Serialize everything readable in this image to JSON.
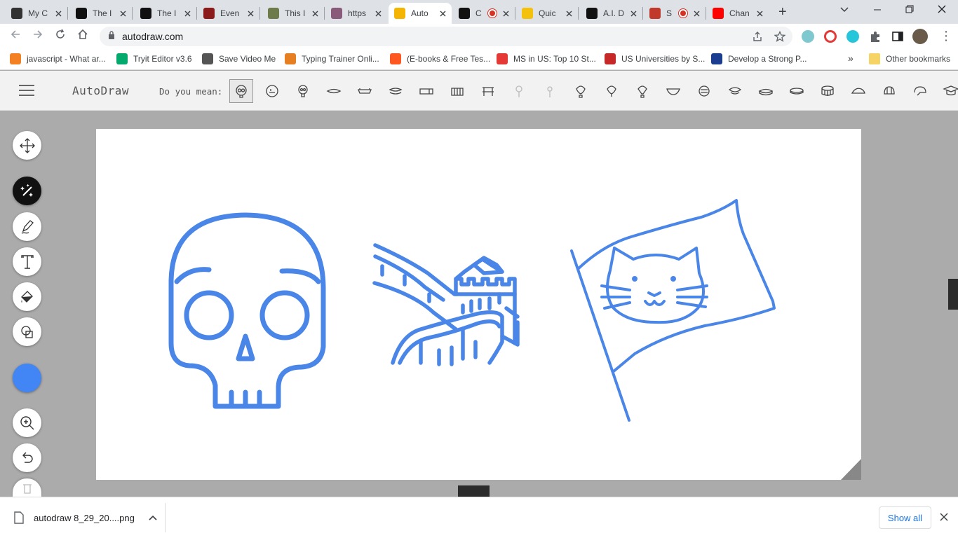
{
  "tabs": [
    {
      "title": "My C",
      "icon": "sparkle-icon",
      "color": "#333333"
    },
    {
      "title": "The I",
      "icon": "e-logo-icon",
      "color": "#111111"
    },
    {
      "title": "The I",
      "icon": "openai-icon",
      "color": "#111111"
    },
    {
      "title": "Even",
      "icon": "hat-icon",
      "color": "#8b1a1a"
    },
    {
      "title": "This I",
      "icon": "photo-icon",
      "color": "#6d7a4a"
    },
    {
      "title": "https",
      "icon": "portrait-icon",
      "color": "#8a5a7a"
    },
    {
      "title": "Auto",
      "icon": "autodraw-icon",
      "color": "#f4b400",
      "active": true
    },
    {
      "title": "C",
      "icon": "mask-icon",
      "color": "#111111",
      "recording": true
    },
    {
      "title": "Quic",
      "icon": "pencil-icon",
      "color": "#f4c20d"
    },
    {
      "title": "A.I. D",
      "icon": "piano-icon",
      "color": "#111111"
    },
    {
      "title": "S",
      "icon": "game-icon",
      "color": "#c0392b",
      "recording": true
    },
    {
      "title": "Chan",
      "icon": "youtube-icon",
      "color": "#ff0000"
    }
  ],
  "address": {
    "url": "autodraw.com"
  },
  "bookmarks": [
    {
      "label": "javascript - What ar...",
      "color": "#f48024"
    },
    {
      "label": "Tryit Editor v3.6",
      "color": "#04aa6d"
    },
    {
      "label": "Save Video Me",
      "color": "#555555"
    },
    {
      "label": "Typing Trainer Onli...",
      "color": "#e67e22"
    },
    {
      "label": "(E-books & Free Tes...",
      "color": "#ff5722"
    },
    {
      "label": "MS in US: Top 10 St...",
      "color": "#e53935"
    },
    {
      "label": "US Universities by S...",
      "color": "#c62828"
    },
    {
      "label": "Develop a Strong P...",
      "color": "#1a3d8f"
    }
  ],
  "bookmarks_more": "»",
  "other_bookmarks": "Other bookmarks",
  "app": {
    "name": "AutoDraw",
    "suggest_label": "Do you mean:"
  },
  "download": {
    "filename": "autodraw 8_29_20....png",
    "show_all": "Show all"
  },
  "colors": {
    "accent": "#4285f4",
    "stroke": "#4a86e8"
  }
}
